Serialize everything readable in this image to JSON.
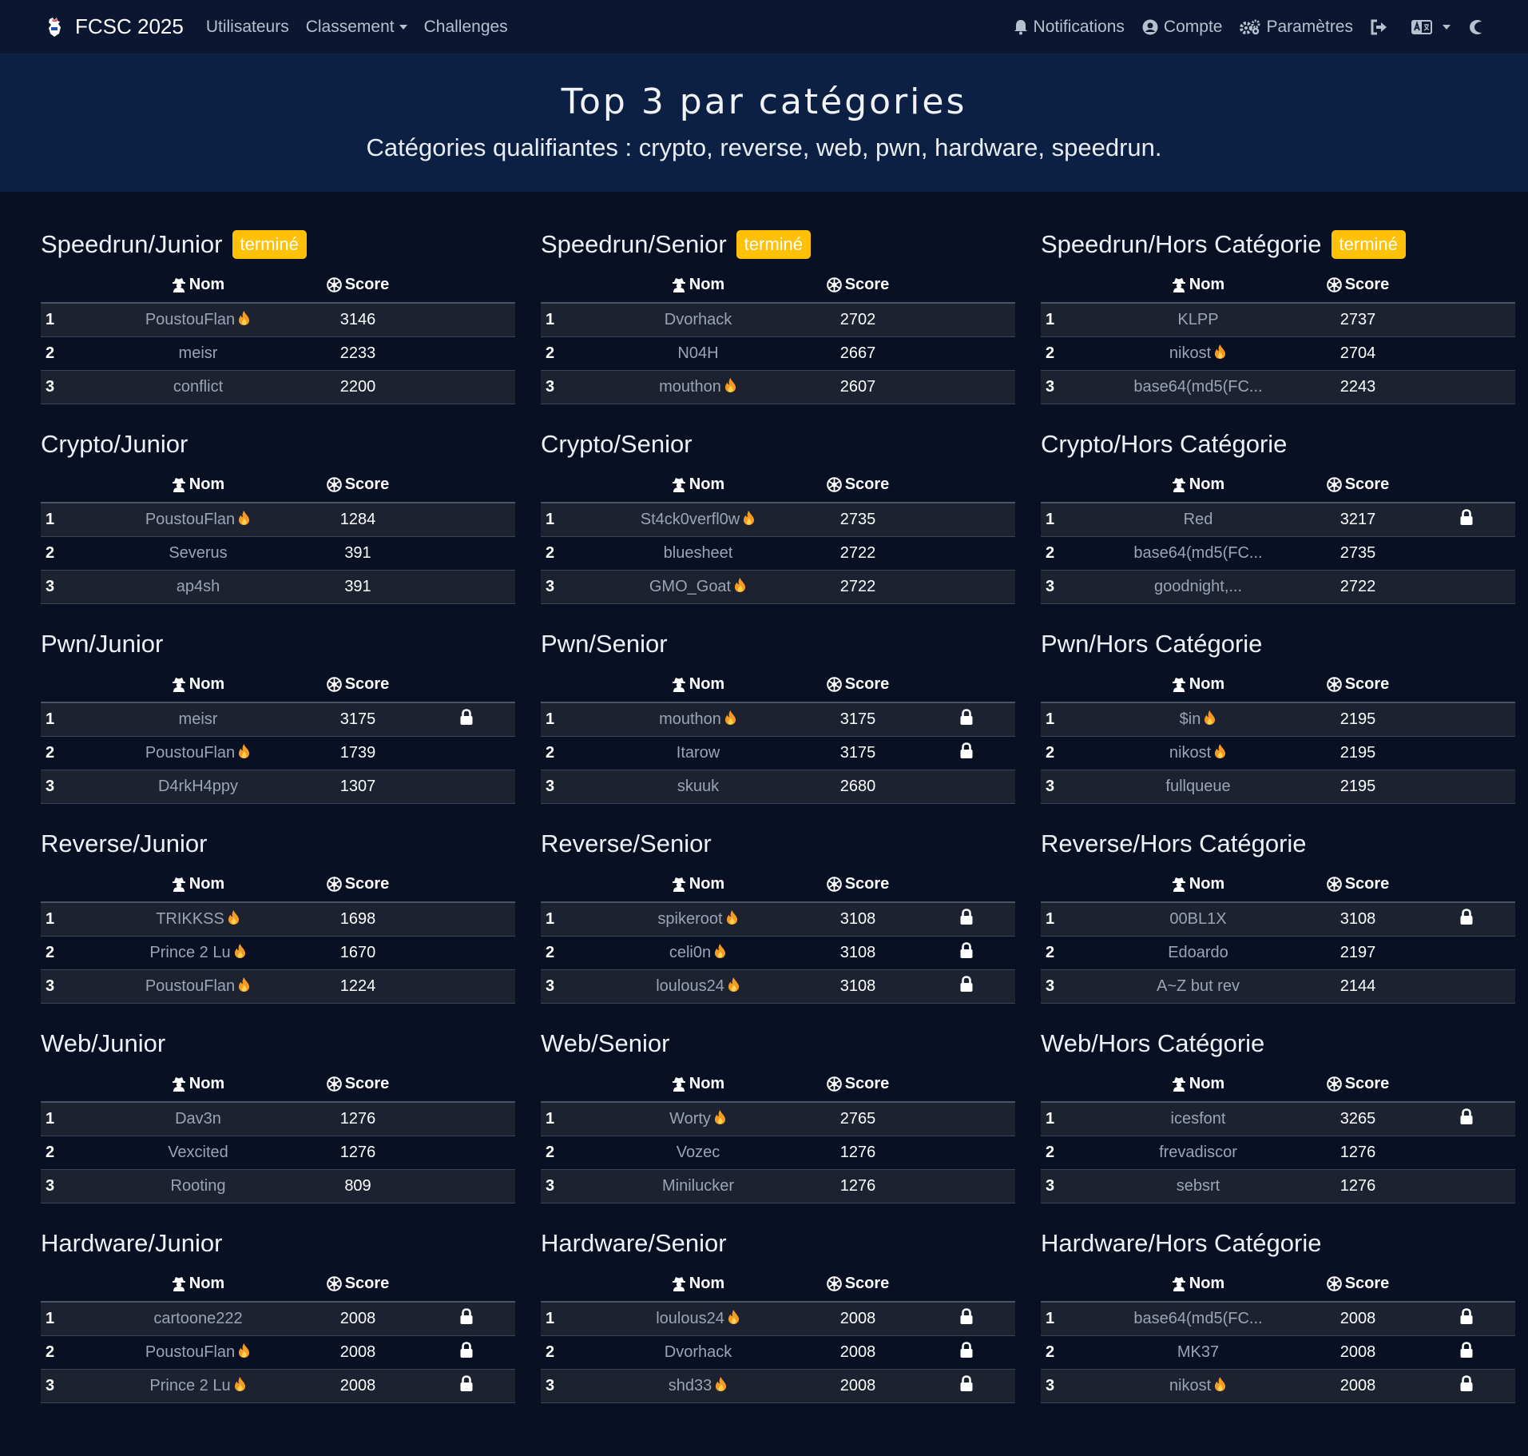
{
  "nav": {
    "brand": "FCSC 2025",
    "links": [
      "Utilisateurs",
      "Classement",
      "Challenges"
    ],
    "right": [
      "Notifications",
      "Compte",
      "Paramètres"
    ]
  },
  "hero": {
    "title": "Top 3 par catégories",
    "subtitle": "Catégories qualifiantes : crypto, reverse, web, pwn, hardware, speedrun."
  },
  "table_headers": {
    "name": "Nom",
    "score": "Score"
  },
  "blocks": [
    {
      "title": "Speedrun/Junior",
      "badge": "terminé",
      "rows": [
        {
          "rank": "1",
          "name": "PoustouFlan",
          "fire": true,
          "score": "3146",
          "locked": false
        },
        {
          "rank": "2",
          "name": "meisr",
          "fire": false,
          "score": "2233",
          "locked": false
        },
        {
          "rank": "3",
          "name": "conflict",
          "fire": false,
          "score": "2200",
          "locked": false
        }
      ]
    },
    {
      "title": "Speedrun/Senior",
      "badge": "terminé",
      "rows": [
        {
          "rank": "1",
          "name": "Dvorhack",
          "fire": false,
          "score": "2702",
          "locked": false
        },
        {
          "rank": "2",
          "name": "N04H",
          "fire": false,
          "score": "2667",
          "locked": false
        },
        {
          "rank": "3",
          "name": "mouthon",
          "fire": true,
          "score": "2607",
          "locked": false
        }
      ]
    },
    {
      "title": "Speedrun/Hors Catégorie",
      "badge": "terminé",
      "rows": [
        {
          "rank": "1",
          "name": "KLPP",
          "fire": false,
          "score": "2737",
          "locked": false
        },
        {
          "rank": "2",
          "name": "nikost",
          "fire": true,
          "score": "2704",
          "locked": false
        },
        {
          "rank": "3",
          "name": "base64(md5(FC...",
          "fire": false,
          "score": "2243",
          "locked": false
        }
      ]
    },
    {
      "title": "Crypto/Junior",
      "badge": "",
      "rows": [
        {
          "rank": "1",
          "name": "PoustouFlan",
          "fire": true,
          "score": "1284",
          "locked": false
        },
        {
          "rank": "2",
          "name": "Severus",
          "fire": false,
          "score": "391",
          "locked": false
        },
        {
          "rank": "3",
          "name": "ap4sh",
          "fire": false,
          "score": "391",
          "locked": false
        }
      ]
    },
    {
      "title": "Crypto/Senior",
      "badge": "",
      "rows": [
        {
          "rank": "1",
          "name": "St4ck0verfl0w",
          "fire": true,
          "score": "2735",
          "locked": false
        },
        {
          "rank": "2",
          "name": "bluesheet",
          "fire": false,
          "score": "2722",
          "locked": false
        },
        {
          "rank": "3",
          "name": "GMO_Goat",
          "fire": true,
          "score": "2722",
          "locked": false
        }
      ]
    },
    {
      "title": "Crypto/Hors Catégorie",
      "badge": "",
      "rows": [
        {
          "rank": "1",
          "name": "Red",
          "fire": false,
          "score": "3217",
          "locked": true
        },
        {
          "rank": "2",
          "name": "base64(md5(FC...",
          "fire": false,
          "score": "2735",
          "locked": false
        },
        {
          "rank": "3",
          "name": "goodnight,...",
          "fire": false,
          "score": "2722",
          "locked": false
        }
      ]
    },
    {
      "title": "Pwn/Junior",
      "badge": "",
      "rows": [
        {
          "rank": "1",
          "name": "meisr",
          "fire": false,
          "score": "3175",
          "locked": true
        },
        {
          "rank": "2",
          "name": "PoustouFlan",
          "fire": true,
          "score": "1739",
          "locked": false
        },
        {
          "rank": "3",
          "name": "D4rkH4ppy",
          "fire": false,
          "score": "1307",
          "locked": false
        }
      ]
    },
    {
      "title": "Pwn/Senior",
      "badge": "",
      "rows": [
        {
          "rank": "1",
          "name": "mouthon",
          "fire": true,
          "score": "3175",
          "locked": true
        },
        {
          "rank": "2",
          "name": "Itarow",
          "fire": false,
          "score": "3175",
          "locked": true
        },
        {
          "rank": "3",
          "name": "skuuk",
          "fire": false,
          "score": "2680",
          "locked": false
        }
      ]
    },
    {
      "title": "Pwn/Hors Catégorie",
      "badge": "",
      "rows": [
        {
          "rank": "1",
          "name": "$in",
          "fire": true,
          "score": "2195",
          "locked": false
        },
        {
          "rank": "2",
          "name": "nikost",
          "fire": true,
          "score": "2195",
          "locked": false
        },
        {
          "rank": "3",
          "name": "fullqueue",
          "fire": false,
          "score": "2195",
          "locked": false
        }
      ]
    },
    {
      "title": "Reverse/Junior",
      "badge": "",
      "rows": [
        {
          "rank": "1",
          "name": "TRIKKSS",
          "fire": true,
          "score": "1698",
          "locked": false
        },
        {
          "rank": "2",
          "name": "Prince 2 Lu",
          "fire": true,
          "score": "1670",
          "locked": false
        },
        {
          "rank": "3",
          "name": "PoustouFlan",
          "fire": true,
          "score": "1224",
          "locked": false
        }
      ]
    },
    {
      "title": "Reverse/Senior",
      "badge": "",
      "rows": [
        {
          "rank": "1",
          "name": "spikeroot",
          "fire": true,
          "score": "3108",
          "locked": true
        },
        {
          "rank": "2",
          "name": "celi0n",
          "fire": true,
          "score": "3108",
          "locked": true
        },
        {
          "rank": "3",
          "name": "loulous24",
          "fire": true,
          "score": "3108",
          "locked": true
        }
      ]
    },
    {
      "title": "Reverse/Hors Catégorie",
      "badge": "",
      "rows": [
        {
          "rank": "1",
          "name": "00BL1X",
          "fire": false,
          "score": "3108",
          "locked": true
        },
        {
          "rank": "2",
          "name": "Edoardo",
          "fire": false,
          "score": "2197",
          "locked": false
        },
        {
          "rank": "3",
          "name": "A~Z but rev",
          "fire": false,
          "score": "2144",
          "locked": false
        }
      ]
    },
    {
      "title": "Web/Junior",
      "badge": "",
      "rows": [
        {
          "rank": "1",
          "name": "Dav3n",
          "fire": false,
          "score": "1276",
          "locked": false
        },
        {
          "rank": "2",
          "name": "Vexcited",
          "fire": false,
          "score": "1276",
          "locked": false
        },
        {
          "rank": "3",
          "name": "Rooting",
          "fire": false,
          "score": "809",
          "locked": false
        }
      ]
    },
    {
      "title": "Web/Senior",
      "badge": "",
      "rows": [
        {
          "rank": "1",
          "name": "Worty",
          "fire": true,
          "score": "2765",
          "locked": false
        },
        {
          "rank": "2",
          "name": "Vozec",
          "fire": false,
          "score": "1276",
          "locked": false
        },
        {
          "rank": "3",
          "name": "Minilucker",
          "fire": false,
          "score": "1276",
          "locked": false
        }
      ]
    },
    {
      "title": "Web/Hors Catégorie",
      "badge": "",
      "rows": [
        {
          "rank": "1",
          "name": "icesfont",
          "fire": false,
          "score": "3265",
          "locked": true
        },
        {
          "rank": "2",
          "name": "frevadiscor",
          "fire": false,
          "score": "1276",
          "locked": false
        },
        {
          "rank": "3",
          "name": "sebsrt",
          "fire": false,
          "score": "1276",
          "locked": false
        }
      ]
    },
    {
      "title": "Hardware/Junior",
      "badge": "",
      "rows": [
        {
          "rank": "1",
          "name": "cartoone222",
          "fire": false,
          "score": "2008",
          "locked": true
        },
        {
          "rank": "2",
          "name": "PoustouFlan",
          "fire": true,
          "score": "2008",
          "locked": true
        },
        {
          "rank": "3",
          "name": "Prince 2 Lu",
          "fire": true,
          "score": "2008",
          "locked": true
        }
      ]
    },
    {
      "title": "Hardware/Senior",
      "badge": "",
      "rows": [
        {
          "rank": "1",
          "name": "loulous24",
          "fire": true,
          "score": "2008",
          "locked": true
        },
        {
          "rank": "2",
          "name": "Dvorhack",
          "fire": false,
          "score": "2008",
          "locked": true
        },
        {
          "rank": "3",
          "name": "shd33",
          "fire": true,
          "score": "2008",
          "locked": true
        }
      ]
    },
    {
      "title": "Hardware/Hors Catégorie",
      "badge": "",
      "rows": [
        {
          "rank": "1",
          "name": "base64(md5(FC...",
          "fire": false,
          "score": "2008",
          "locked": true
        },
        {
          "rank": "2",
          "name": "MK37",
          "fire": false,
          "score": "2008",
          "locked": true
        },
        {
          "rank": "3",
          "name": "nikost",
          "fire": true,
          "score": "2008",
          "locked": true
        }
      ]
    }
  ]
}
